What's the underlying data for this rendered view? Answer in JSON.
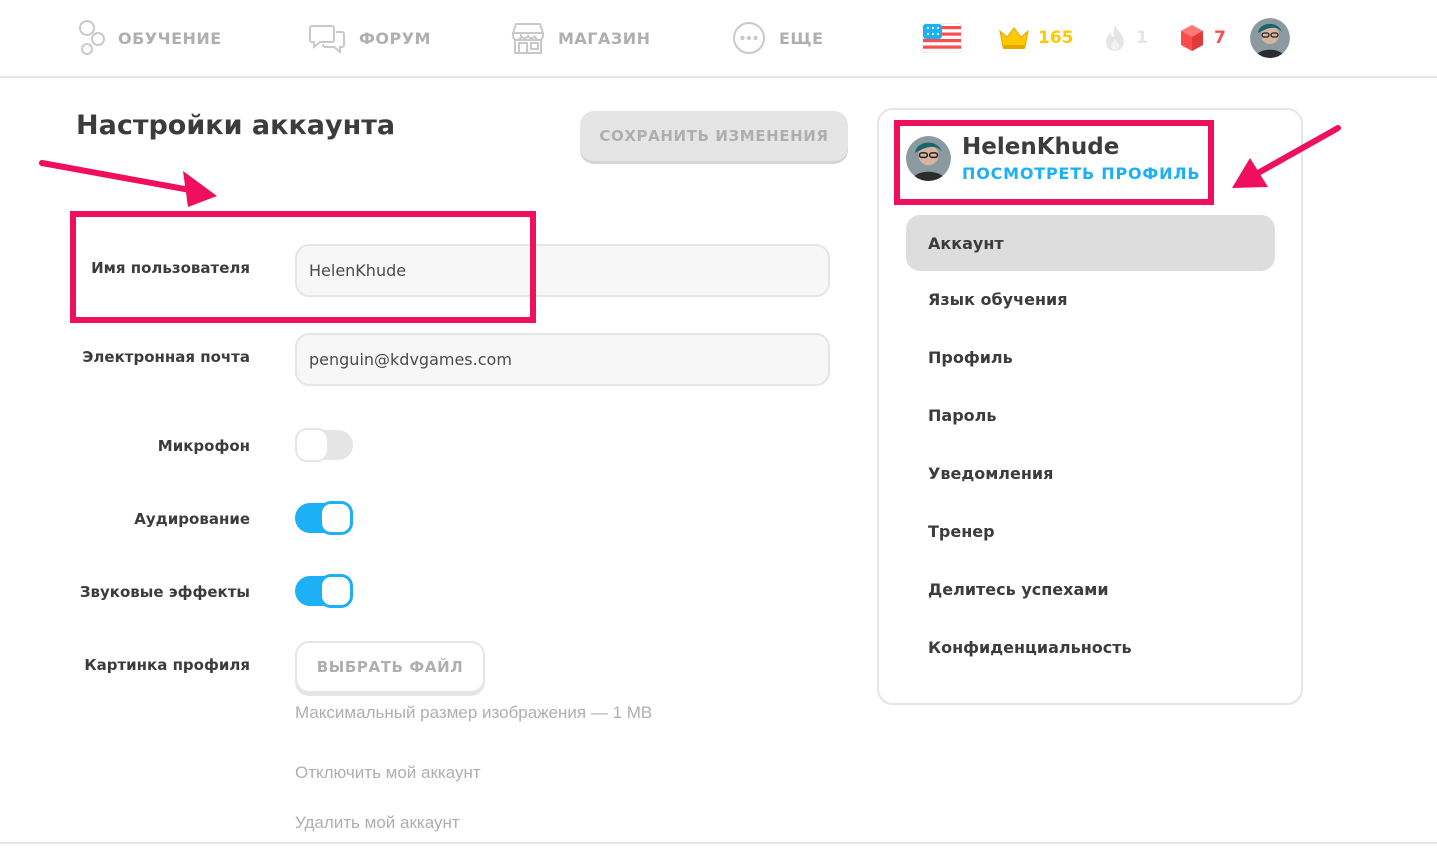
{
  "nav": {
    "learn": "ОБУЧЕНИЕ",
    "forum": "ФОРУМ",
    "shop": "МАГАЗИН",
    "more": "ЕЩЕ"
  },
  "stats": {
    "crowns": "165",
    "streak": "1",
    "gems": "7",
    "language_flag": "us-flag-icon"
  },
  "page": {
    "title": "Настройки аккаунта",
    "save_button": "СОХРАНИТЬ ИЗМЕНЕНИЯ"
  },
  "form": {
    "username_label": "Имя пользователя",
    "username_value": "HelenKhude",
    "email_label": "Электронная почта",
    "email_value": "penguin@kdvgames.com",
    "microphone_label": "Микрофон",
    "microphone_on": false,
    "listening_label": "Аудирование",
    "listening_on": true,
    "sound_effects_label": "Звуковые эффекты",
    "sound_effects_on": true,
    "profile_picture_label": "Картинка профиля",
    "choose_file_button": "ВЫБРАТЬ ФАЙЛ",
    "max_size_hint": "Максимальный размер изображения — 1 MB",
    "deactivate_link": "Отключить мой аккаунт",
    "delete_link": "Удалить мой аккаунт"
  },
  "sidebar": {
    "username": "HelenKhude",
    "view_profile": "ПОСМОТРЕТЬ ПРОФИЛЬ",
    "items": [
      {
        "label": "Аккаунт",
        "active": true
      },
      {
        "label": "Язык обучения",
        "active": false
      },
      {
        "label": "Профиль",
        "active": false
      },
      {
        "label": "Пароль",
        "active": false
      },
      {
        "label": "Уведомления",
        "active": false
      },
      {
        "label": "Тренер",
        "active": false
      },
      {
        "label": "Делитесь успехами",
        "active": false
      },
      {
        "label": "Конфиденциальность",
        "active": false
      }
    ]
  },
  "colors": {
    "accent_blue": "#1cb0f6",
    "crown_gold": "#ffc800",
    "gem_red": "#ff4b4b",
    "annotation_pink": "#ef0f5d",
    "muted_gray": "#afafaf"
  }
}
